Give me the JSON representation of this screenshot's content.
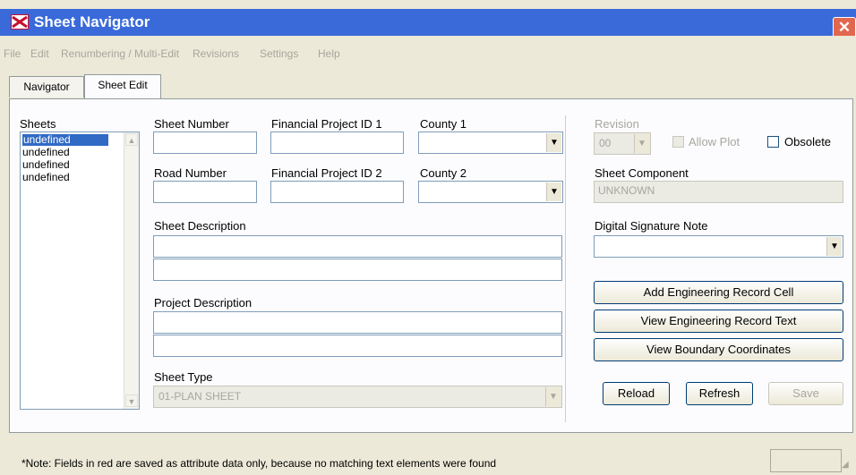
{
  "window": {
    "title": "Sheet Navigator",
    "close_glyph": "✕"
  },
  "menu": [
    "File",
    "Edit",
    "Renumbering / Multi-Edit",
    "Revisions",
    "Settings",
    "Help"
  ],
  "tabs": [
    "Navigator",
    "Sheet Edit"
  ],
  "active_tab": "Sheet Edit",
  "sheets": {
    "label": "Sheets",
    "items": [
      "undefined",
      "undefined",
      "undefined",
      "undefined"
    ],
    "selected_index": 0
  },
  "fields": {
    "sheet_number": {
      "label": "Sheet Number",
      "value": ""
    },
    "financial_project_id_1": {
      "label": "Financial Project ID 1",
      "value": ""
    },
    "county_1": {
      "label": "County 1",
      "value": ""
    },
    "road_number": {
      "label": "Road Number",
      "value": ""
    },
    "financial_project_id_2": {
      "label": "Financial Project ID 2",
      "value": ""
    },
    "county_2": {
      "label": "County 2",
      "value": ""
    },
    "sheet_description": {
      "label": "Sheet Description",
      "line1": "",
      "line2": ""
    },
    "project_description": {
      "label": "Project Description",
      "line1": "",
      "line2": ""
    },
    "sheet_type": {
      "label": "Sheet Type",
      "value": "01-PLAN SHEET"
    }
  },
  "right": {
    "revision": {
      "label": "Revision",
      "value": "00"
    },
    "allow_plot": {
      "label": "Allow Plot",
      "checked": false
    },
    "obsolete": {
      "label": "Obsolete",
      "checked": false
    },
    "sheet_component": {
      "label": "Sheet Component",
      "value": "UNKNOWN"
    },
    "digital_signature": {
      "label": "Digital Signature Note",
      "value": ""
    },
    "buttons": {
      "add_eng_record": "Add Engineering Record Cell",
      "view_eng_record": "View Engineering Record Text",
      "view_boundary": "View Boundary Coordinates",
      "reload": "Reload",
      "refresh": "Refresh",
      "save": "Save"
    }
  },
  "status": {
    "note": "*Note: Fields in red are saved as attribute data only, because no matching text elements were found"
  },
  "icons": {
    "dropdown": "▼",
    "scroll_up": "▲",
    "scroll_down": "▼",
    "grip": "◢"
  },
  "colors": {
    "titlebar": "#3a6ad9",
    "selection": "#316ac5",
    "disabled_text": "#a7a69e",
    "close_button": "#e2674f"
  }
}
